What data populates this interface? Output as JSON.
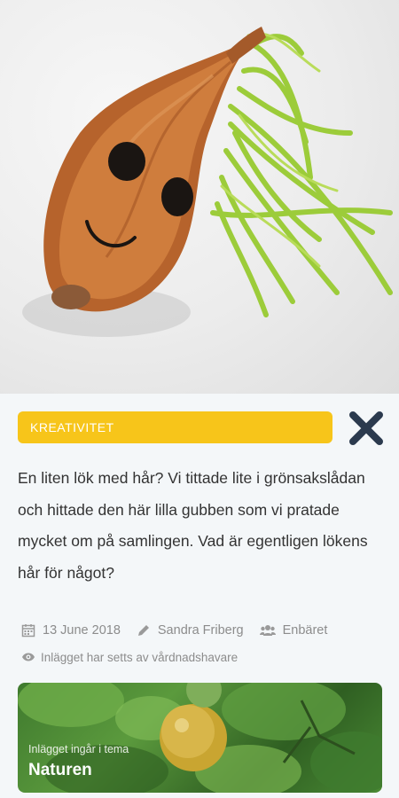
{
  "post": {
    "category": "KREATIVITET",
    "text": "En liten lök med hår? Vi tittade lite i grönsakslådan och hittade den här lilla gubben som vi pratade mycket om på samlingen. Vad är egentligen lökens hår för något?",
    "date": "13 June 2018",
    "author": "Sandra Friberg",
    "group": "Enbäret",
    "seen_status": "Inlägget har setts av vårdnadshavare"
  },
  "theme": {
    "subtitle": "Inlägget ingår i tema",
    "title": "Naturen"
  },
  "colors": {
    "accent_yellow": "#f7c51a",
    "close_navy": "#2b3a4e",
    "meta_gray": "#8c8c8c",
    "background": "#f4f7f9"
  },
  "icons": {
    "close": "close-icon",
    "date": "calendar-icon",
    "author": "pencil-icon",
    "group": "users-icon",
    "seen": "eye-icon"
  }
}
